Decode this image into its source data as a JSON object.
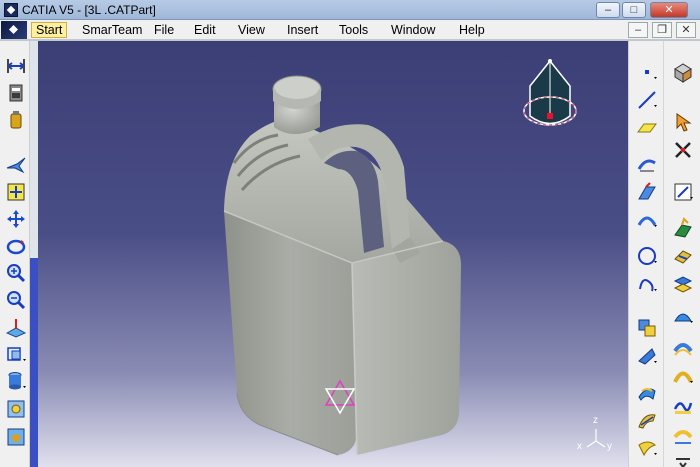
{
  "window": {
    "title": "CATIA V5 - [3L .CATPart]",
    "minimize": "–",
    "maximize": "□",
    "close": "✕"
  },
  "menu": {
    "items": [
      "Start",
      "SmarTeam",
      "File",
      "Edit",
      "View",
      "Insert",
      "Tools",
      "Window",
      "Help"
    ],
    "mdi": {
      "minimize": "–",
      "restore": "❐",
      "close": "✕"
    }
  },
  "left_toolbar": {
    "icons": [
      "measure-between-icon",
      "measure-item-icon",
      "measure-inertia-icon",
      "fly-mode-icon",
      "fit-all-in-icon",
      "pan-icon",
      "rotate-icon",
      "zoom-in-icon",
      "zoom-out-icon",
      "normal-view-icon",
      "quick-view-icon",
      "view-mode-icon",
      "hide-show-icon",
      "swap-visible-space-icon"
    ]
  },
  "right_toolbar": {
    "icons": [
      "point-icon",
      "line-icon",
      "plane-icon",
      "sketch-icon",
      "extrude-icon",
      "revolve-icon",
      "sweep-icon",
      "circle-icon",
      "spline-icon",
      "helix-icon",
      "join-icon",
      "split-icon",
      "fillet-icon",
      "translate-icon",
      "fill-icon",
      "curve-smooth-icon",
      "top-view-icon",
      "select-cursor-icon",
      "snap-to-point-icon",
      "sketcher-icon",
      "boundary-icon",
      "extract-icon",
      "intersection-icon",
      "projection-icon",
      "offset-icon",
      "blend-icon"
    ]
  },
  "viewport": {
    "axis_labels": {
      "x": "x",
      "y": "y",
      "z": "z"
    },
    "colors": {
      "background_top": "#3c3f76",
      "background_bottom": "#e0e0ee",
      "part": "#a7aba4",
      "compass_accent": "#e8102a",
      "compass_fill": "#1a3a4a"
    }
  }
}
